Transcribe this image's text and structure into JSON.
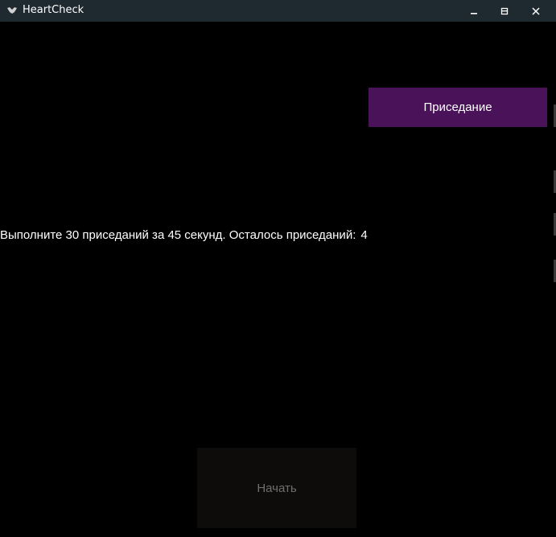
{
  "window": {
    "title": "HeartCheck",
    "app_icon": "bird-logo-icon",
    "controls": {
      "minimize_icon": "minimize-icon",
      "maximize_icon": "maximize-icon",
      "close_icon": "close-icon"
    }
  },
  "main": {
    "exercise_button_label": "Приседание",
    "instruction_text": "Выполните 30 приседаний за 45 секунд. Осталось приседаний:",
    "remaining_count": "4",
    "start_button_label": "Начать"
  },
  "colors": {
    "background": "#000000",
    "titlebar": "#1f2a30",
    "accent": "#4a1259",
    "disabled_button": "#0e0c0b",
    "disabled_text": "#6f6f6f"
  }
}
